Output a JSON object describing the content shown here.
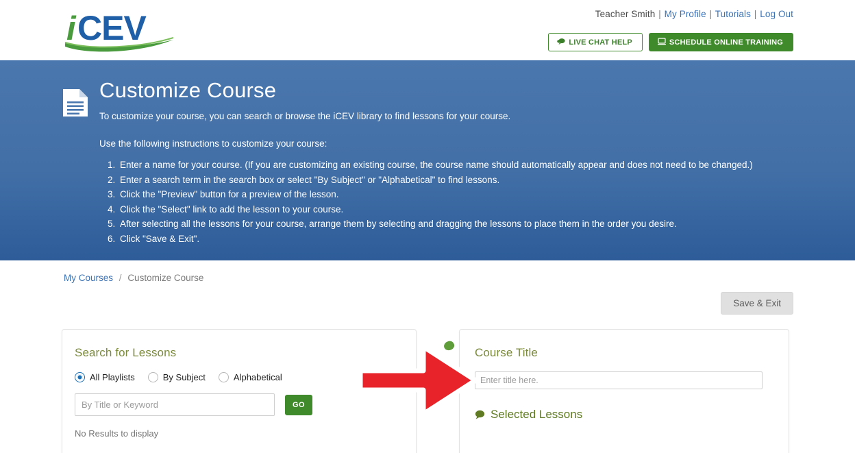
{
  "brand": {
    "logo_i": "i",
    "logo_cev": "CEV",
    "accent_green": "#3f8a2b",
    "accent_blue": "#1f5fa8",
    "hero_blue": "#426fa6",
    "heading_olive": "#7b8a3d",
    "arrow_red": "#e8232a"
  },
  "topbar": {
    "user_name": "Teacher Smith",
    "sep": "|",
    "links": [
      {
        "label": "My Profile"
      },
      {
        "label": "Tutorials"
      },
      {
        "label": "Log Out"
      }
    ],
    "live_chat_button": "LIVE CHAT HELP",
    "live_chat_icon": "chat-bubble-icon",
    "schedule_button": "SCHEDULE ONLINE TRAINING",
    "schedule_icon": "monitor-icon"
  },
  "hero": {
    "icon": "document-icon",
    "title": "Customize Course",
    "subtitle": "To customize your course, you can search or browse the iCEV library to find lessons for your course.",
    "lead_in": "Use the following instructions to customize your course:",
    "steps": [
      "Enter a name for your course. (If you are customizing an existing course, the course name should automatically appear and does not need to be changed.)",
      "Enter a search term in the search box or select \"By Subject\" or \"Alphabetical\" to find lessons.",
      "Click the \"Preview\" button for a preview of the lesson.",
      "Click the \"Select\" link to add the lesson to your course.",
      "After selecting all the lessons for your course, arrange them by selecting and dragging the lessons to place them in the order you desire.",
      "Click \"Save & Exit\"."
    ]
  },
  "breadcrumb": {
    "root": "My Courses",
    "separator": "/",
    "current": "Customize Course"
  },
  "actions": {
    "save_exit": "Save & Exit"
  },
  "search_panel": {
    "heading": "Search for Lessons",
    "options": [
      {
        "label": "All Playlists",
        "selected": true
      },
      {
        "label": "By Subject",
        "selected": false
      },
      {
        "label": "Alphabetical",
        "selected": false
      }
    ],
    "search_placeholder": "By Title or Keyword",
    "search_value": "",
    "go_button": "GO",
    "empty_state": "No Results to display"
  },
  "course_panel": {
    "heading": "Course Title",
    "title_placeholder": "Enter title here.",
    "title_value": "",
    "selected_lessons_label": "Selected Lessons",
    "selected_lessons_icon": "speech-bubble-icon"
  },
  "annotation": {
    "arrow_icon": "red-arrow-right-icon",
    "points_to": "course-title-input"
  }
}
